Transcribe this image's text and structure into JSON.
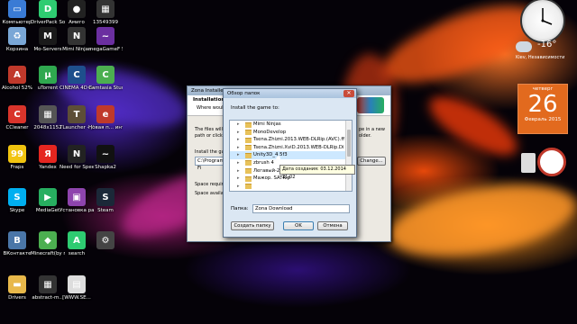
{
  "desktop_icons": [
    {
      "label": "Компьютер",
      "icon": "computer-icon",
      "color": "#3a7bd5",
      "glyph": "▭",
      "col": 0,
      "row": 0
    },
    {
      "label": "Корзина",
      "icon": "recycle-bin-icon",
      "color": "#7aa7d6",
      "glyph": "♻",
      "col": 0,
      "row": 1
    },
    {
      "label": "Alcohol 52%",
      "icon": "alcohol-icon",
      "color": "#c0392b",
      "glyph": "A",
      "col": 0,
      "row": 2
    },
    {
      "label": "CCleaner",
      "icon": "ccleaner-icon",
      "color": "#d9342b",
      "glyph": "C",
      "col": 0,
      "row": 3
    },
    {
      "label": "Fraps",
      "icon": "fraps-icon",
      "color": "#f1c40f",
      "glyph": "99",
      "col": 0,
      "row": 4
    },
    {
      "label": "Skype",
      "icon": "skype-icon",
      "color": "#00aff0",
      "glyph": "S",
      "col": 0,
      "row": 5
    },
    {
      "label": "ВКонтакте",
      "icon": "vk-icon",
      "color": "#4a76a8",
      "glyph": "B",
      "col": 0,
      "row": 6
    },
    {
      "label": "Drivers",
      "icon": "folder-icon",
      "color": "#e8b84a",
      "glyph": "▬",
      "col": 0,
      "row": 7
    },
    {
      "label": "DriverPack Solution",
      "icon": "driverpack-icon",
      "color": "#2ecc71",
      "glyph": "D",
      "col": 1,
      "row": 0
    },
    {
      "label": "Mo-Servers",
      "icon": "mo-servers-icon",
      "color": "#1a1a1a",
      "glyph": "M",
      "col": 1,
      "row": 1
    },
    {
      "label": "uTorrent",
      "icon": "utorrent-icon",
      "color": "#2fa84f",
      "glyph": "µ",
      "col": 1,
      "row": 2
    },
    {
      "label": "2048x1152",
      "icon": "image-icon",
      "color": "#555",
      "glyph": "▦",
      "col": 1,
      "row": 3
    },
    {
      "label": "Yandex",
      "icon": "yandex-icon",
      "color": "#e52620",
      "glyph": "Я",
      "col": 1,
      "row": 4
    },
    {
      "label": "MediaGet",
      "icon": "mediaget-icon",
      "color": "#27ae60",
      "glyph": "▶",
      "col": 1,
      "row": 5
    },
    {
      "label": "Minecraft(by minecraft-...",
      "icon": "minecraft-icon",
      "color": "#4caf50",
      "glyph": "◆",
      "col": 1,
      "row": 6
    },
    {
      "label": "abstract-m...",
      "icon": "image-icon",
      "color": "#333",
      "glyph": "▦",
      "col": 1,
      "row": 7
    },
    {
      "label": "Амиго",
      "icon": "amigo-icon",
      "color": "#222",
      "glyph": "●",
      "col": 2,
      "row": 0
    },
    {
      "label": "Mimi Ninjas",
      "icon": "game-icon",
      "color": "#333",
      "glyph": "N",
      "col": 2,
      "row": 1
    },
    {
      "label": "CINEMA 4D 64 Bit",
      "icon": "cinema4d-icon",
      "color": "#1e4f8c",
      "glyph": "C",
      "col": 2,
      "row": 2
    },
    {
      "label": "TLauncher - (1)",
      "icon": "tlauncher-icon",
      "color": "#5d4e37",
      "glyph": "T",
      "col": 2,
      "row": 3
    },
    {
      "label": "Need for Speed Most...",
      "icon": "nfs-icon",
      "color": "#222",
      "glyph": "N",
      "col": 2,
      "row": 4
    },
    {
      "label": "Установка разрешения",
      "icon": "settings-icon",
      "color": "#8e44ad",
      "glyph": "▣",
      "col": 2,
      "row": 5
    },
    {
      "label": "search",
      "icon": "search-app-icon",
      "color": "#2ecc71",
      "glyph": "A",
      "col": 2,
      "row": 6
    },
    {
      "label": "[WWW.SE...",
      "icon": "document-icon",
      "color": "#ddd",
      "glyph": "▤",
      "col": 2,
      "row": 7
    },
    {
      "label": "13549399",
      "icon": "image-icon",
      "color": "#333",
      "glyph": "▦",
      "col": 3,
      "row": 0
    },
    {
      "label": "megaGameF Shapka",
      "icon": "game-icon",
      "color": "#6b2fa0",
      "glyph": "~",
      "col": 3,
      "row": 1
    },
    {
      "label": "Camtasia Studio 7",
      "icon": "camtasia-icon",
      "color": "#4caf50",
      "glyph": "C",
      "col": 3,
      "row": 2
    },
    {
      "label": "Новая п... интерне...",
      "icon": "internet-icon",
      "color": "#c0392b",
      "glyph": "e",
      "col": 3,
      "row": 3
    },
    {
      "label": "Shapka2",
      "icon": "game-icon",
      "color": "#111",
      "glyph": "~",
      "col": 3,
      "row": 4
    },
    {
      "label": "Steam",
      "icon": "steam-icon",
      "color": "#1b2838",
      "glyph": "S",
      "col": 3,
      "row": 5
    },
    {
      "label": "",
      "icon": "game-icon",
      "color": "#444",
      "glyph": "⚙",
      "col": 3,
      "row": 6
    }
  ],
  "weather": {
    "temp": "-16°",
    "location": "Kiev, Независимости"
  },
  "calendar": {
    "weekday": "четверг",
    "day": "26",
    "month_year": "Февраль 2015"
  },
  "installer": {
    "title": "Zona Installer",
    "header_title": "Installation fo",
    "header_sub": "Where would",
    "text1": "The files will be installed",
    "text2": "path or click '",
    "text3": "Install the game",
    "path": "C:\\Program Fi",
    "browse_label": "Change...",
    "text_right1": "pe in a new",
    "text_right2": "older.",
    "space_req": "Space require",
    "space_avail": "Space available"
  },
  "browse_dialog": {
    "title": "Обзор папок",
    "prompt": "Install the game to:",
    "tree": [
      "Mimi Ninjas",
      "MonoDevelop",
      "Tsena.Zhizni.2013.WEB-DLRip.(AVC).ff",
      "Tsena.Zhizni.XviD.2013.WEB-DLRip.Di",
      "Unity3D_4.5f3",
      "zbrush 4",
      "Легавый-2 SATRip AVC",
      "Мажор. SATRip",
      "",
      ""
    ],
    "selected_index": 4,
    "tooltip": "Дата создания: 03.12.2014 21:02",
    "folder_label": "Папка:",
    "folder_value": "Zona Download",
    "new_folder_btn": "Создать папку",
    "ok_btn": "OK",
    "cancel_btn": "Отмена"
  }
}
